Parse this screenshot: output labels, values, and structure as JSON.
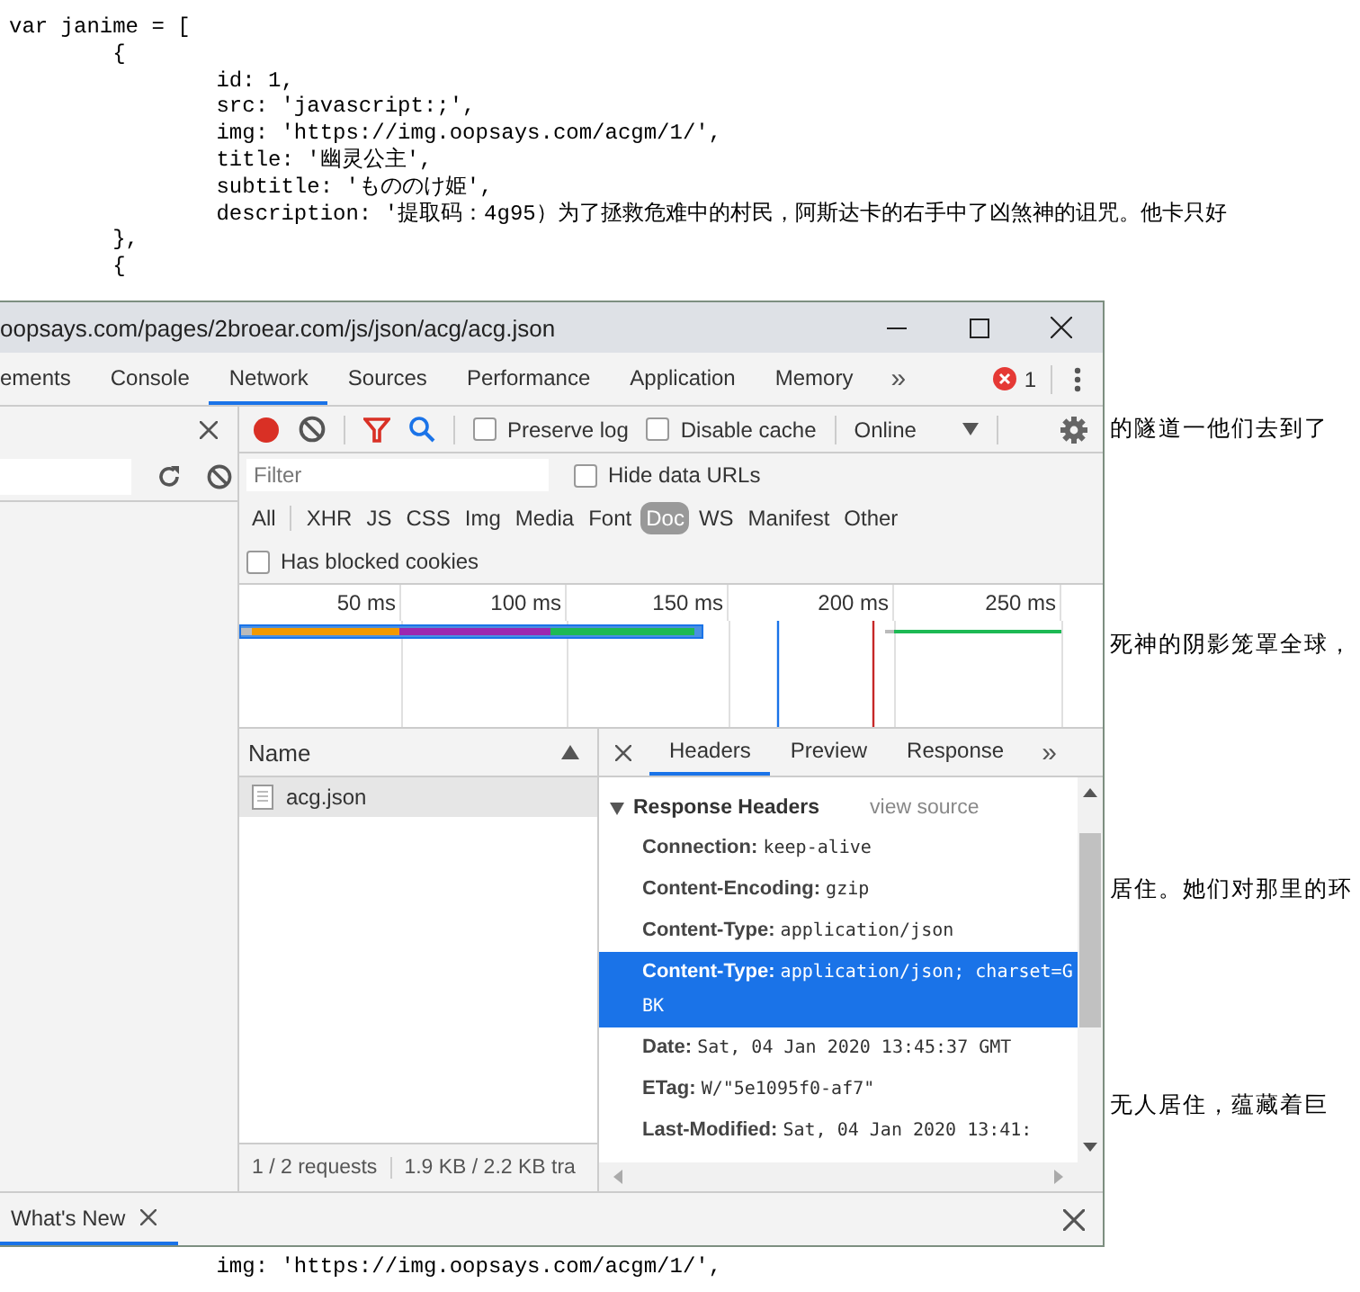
{
  "code_top": [
    "var janime = [",
    "\t{",
    "\t\tid: 1,",
    "\t\tsrc: 'javascript:;',",
    "\t\timg: 'https://img.oopsays.com/acgm/1/',",
    "\t\ttitle: '幽灵公主',",
    "\t\tsubtitle: 'もののけ姫',",
    "\t\tdescription: '提取码：4g95）为了拯救危难中的村民，阿斯达卡的右手中了凶煞神的诅咒。他卡只好",
    "\t},",
    "\t{"
  ],
  "right_fragments": [
    "的隧道一他们去到了",
    "死神的阴影笼罩全球，",
    "居住。她们对那里的环",
    "无人居住，蕴藏着巨"
  ],
  "code_bottom": [
    "\t\timg: 'https://img.oopsays.com/acgm/1/',"
  ],
  "devtools": {
    "title": "oopsays.com/pages/2broear.com/js/json/acg/acg.json",
    "tabs": [
      {
        "label": "ements",
        "selected": false
      },
      {
        "label": "Console",
        "selected": false
      },
      {
        "label": "Network",
        "selected": true
      },
      {
        "label": "Sources",
        "selected": false
      },
      {
        "label": "Performance",
        "selected": false
      },
      {
        "label": "Application",
        "selected": false
      },
      {
        "label": "Memory",
        "selected": false
      }
    ],
    "more_tabs": "»",
    "error_count": "1",
    "network": {
      "recording": true,
      "toolbar_checkboxes": [
        {
          "label": "Preserve log",
          "checked": false
        },
        {
          "label": "Disable cache",
          "checked": false
        }
      ],
      "throttling": "Online",
      "filter": {
        "placeholder": "Filter"
      },
      "hide_data_urls": {
        "label": "Hide data URLs",
        "checked": false
      },
      "type_filters": [
        {
          "label": "All",
          "selected": false
        },
        {
          "label": "XHR",
          "selected": false
        },
        {
          "label": "JS",
          "selected": false
        },
        {
          "label": "CSS",
          "selected": false
        },
        {
          "label": "Img",
          "selected": false
        },
        {
          "label": "Media",
          "selected": false
        },
        {
          "label": "Font",
          "selected": false
        },
        {
          "label": "Doc",
          "selected": true
        },
        {
          "label": "WS",
          "selected": false
        },
        {
          "label": "Manifest",
          "selected": false
        },
        {
          "label": "Other",
          "selected": false
        }
      ],
      "blocked_cookies": {
        "label": "Has blocked cookies",
        "checked": false
      },
      "timeline": {
        "ticks": [
          "50 ms",
          "100 ms",
          "150 ms",
          "200 ms",
          "250 ms"
        ]
      },
      "name_column": "Name",
      "requests": [
        {
          "name": "acg.json",
          "selected": true
        }
      ],
      "status": [
        "1 / 2 requests",
        "1.9 KB / 2.2 KB tra"
      ],
      "detail_tabs": [
        {
          "label": "Headers",
          "selected": true
        },
        {
          "label": "Preview",
          "selected": false
        },
        {
          "label": "Response",
          "selected": false
        }
      ],
      "detail_more": "»",
      "section": {
        "title": "Response Headers",
        "expanded": true,
        "link": "view source"
      },
      "headers": [
        {
          "name": "Connection:",
          "value": "keep-alive",
          "selected": false
        },
        {
          "name": "Content-Encoding:",
          "value": "gzip",
          "selected": false
        },
        {
          "name": "Content-Type:",
          "value": "application/json",
          "selected": false
        },
        {
          "name": "Content-Type:",
          "value": "application/json; charset=GBK",
          "selected": true
        },
        {
          "name": "Date:",
          "value": "Sat, 04 Jan 2020 13:45:37 GMT",
          "selected": false
        },
        {
          "name": "ETag:",
          "value": "W/\"5e1095f0-af7\"",
          "selected": false
        },
        {
          "name": "Last-Modified:",
          "value": "Sat, 04 Jan 2020 13:41:",
          "selected": false
        }
      ]
    },
    "drawer_tabs": [
      {
        "label": "What's New",
        "selected": true
      }
    ]
  }
}
